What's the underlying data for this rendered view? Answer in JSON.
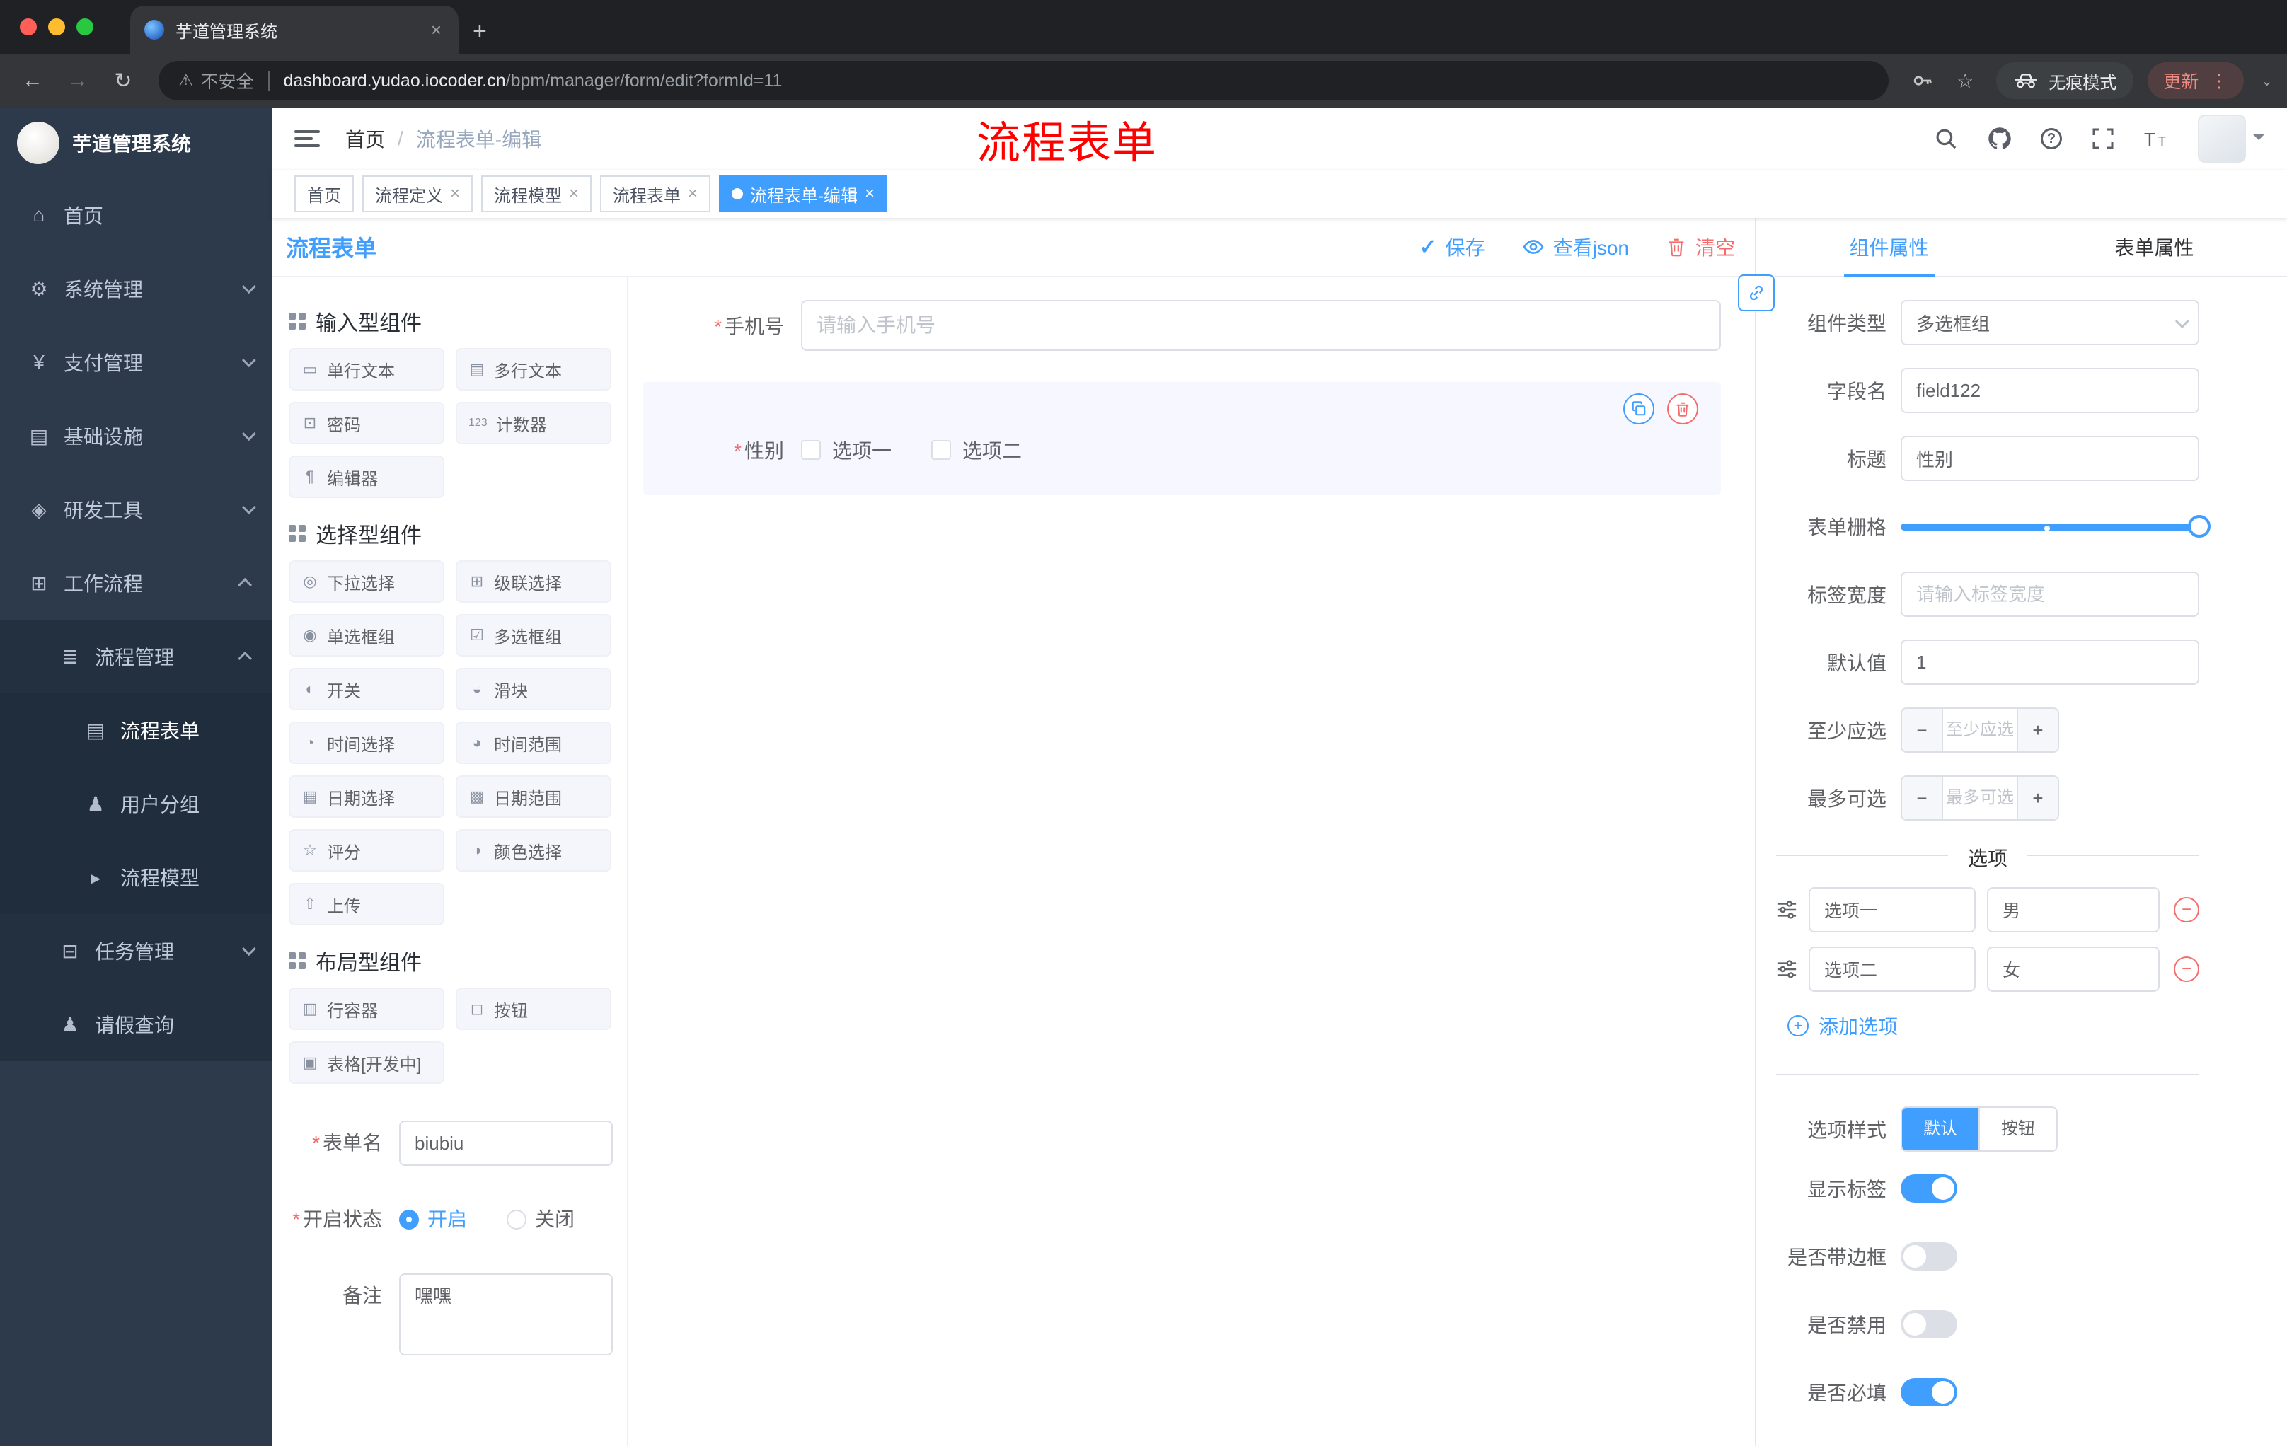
{
  "colors": {
    "primary": "#409eff",
    "danger": "#f56c6c",
    "overlay": "#ff0000",
    "sidebar_bg": "#2d3a4b"
  },
  "misc": {
    "required_mark": "*",
    "close_glyph": "×",
    "plus_glyph": "+",
    "minus_glyph": "−",
    "dots_glyph": "⋮",
    "star_glyph": "☆",
    "back_glyph": "←",
    "forward_glyph": "→",
    "reload_glyph": "↻",
    "warn_glyph": "⚠",
    "check_glyph": "✓",
    "caret_glyph": "⌄"
  },
  "browser": {
    "tab_title": "芋道管理系统",
    "security_label": "不安全",
    "url_domain": "dashboard.yudao.iocoder.cn",
    "url_path": "/bpm/manager/form/edit?formId=11",
    "incognito_label": "无痕模式",
    "update_label": "更新"
  },
  "sidebar": {
    "logo_title": "芋道管理系统",
    "items": [
      {
        "label": "首页",
        "icon": "home",
        "glyph": "⌂"
      },
      {
        "label": "系统管理",
        "icon": "gear",
        "glyph": "⚙"
      },
      {
        "label": "支付管理",
        "icon": "payment",
        "glyph": "¥"
      },
      {
        "label": "基础设施",
        "icon": "infrastructure",
        "glyph": "▤"
      },
      {
        "label": "研发工具",
        "icon": "dev-tools",
        "glyph": "◈"
      },
      {
        "label": "工作流程",
        "icon": "workflow",
        "glyph": "⊞"
      },
      {
        "label": "流程管理",
        "icon": "process-manage",
        "glyph": "≣"
      },
      {
        "label": "流程表单",
        "icon": "process-form",
        "glyph": "▤"
      },
      {
        "label": "用户分组",
        "icon": "user-group",
        "glyph": "♟"
      },
      {
        "label": "流程模型",
        "icon": "process-model",
        "glyph": "▸"
      },
      {
        "label": "任务管理",
        "icon": "task-manage",
        "glyph": "⊟"
      },
      {
        "label": "请假查询",
        "icon": "leave-query",
        "glyph": "♟"
      }
    ]
  },
  "header": {
    "breadcrumb_home": "首页",
    "breadcrumb_sep": "/",
    "breadcrumb_current": "流程表单-编辑",
    "overlay_title": "流程表单"
  },
  "tags": [
    {
      "label": "首页"
    },
    {
      "label": "流程定义"
    },
    {
      "label": "流程模型"
    },
    {
      "label": "流程表单"
    },
    {
      "label": "流程表单-编辑"
    }
  ],
  "designer": {
    "panel_title": "流程表单",
    "save_label": "保存",
    "view_json_label": "查看json",
    "clear_label": "清空",
    "palette": {
      "sections": [
        {
          "title": "输入型组件",
          "items": [
            {
              "label": "单行文本",
              "icon": "single-line-text",
              "glyph": "▭"
            },
            {
              "label": "多行文本",
              "icon": "multi-line-text",
              "glyph": "▤"
            },
            {
              "label": "密码",
              "icon": "password",
              "glyph": "⊡"
            },
            {
              "label": "计数器",
              "icon": "counter",
              "glyph": "123"
            },
            {
              "label": "编辑器",
              "icon": "editor",
              "glyph": "¶"
            }
          ]
        },
        {
          "title": "选择型组件",
          "items": [
            {
              "label": "下拉选择",
              "icon": "select",
              "glyph": "◎"
            },
            {
              "label": "级联选择",
              "icon": "cascader",
              "glyph": "⊞"
            },
            {
              "label": "单选框组",
              "icon": "radio-group",
              "glyph": "◉"
            },
            {
              "label": "多选框组",
              "icon": "checkbox-group",
              "glyph": "☑"
            },
            {
              "label": "开关",
              "icon": "switch",
              "glyph": "◐"
            },
            {
              "label": "滑块",
              "icon": "slider",
              "glyph": "◒"
            },
            {
              "label": "时间选择",
              "icon": "time-picker",
              "glyph": "◔"
            },
            {
              "label": "时间范围",
              "icon": "time-range",
              "glyph": "◕"
            },
            {
              "label": "日期选择",
              "icon": "date-picker",
              "glyph": "▦"
            },
            {
              "label": "日期范围",
              "icon": "date-range",
              "glyph": "▩"
            },
            {
              "label": "评分",
              "icon": "rate",
              "glyph": "☆"
            },
            {
              "label": "颜色选择",
              "icon": "color-picker",
              "glyph": "◑"
            },
            {
              "label": "上传",
              "icon": "upload",
              "glyph": "⇧"
            }
          ]
        },
        {
          "title": "布局型组件",
          "items": [
            {
              "label": "行容器",
              "icon": "row-container",
              "glyph": "▥"
            },
            {
              "label": "按钮",
              "icon": "button",
              "glyph": "◻"
            },
            {
              "label": "表格[开发中]",
              "icon": "table",
              "glyph": "▣"
            }
          ]
        }
      ]
    },
    "form_meta": {
      "name_label": "表单名",
      "name_value": "biubiu",
      "status_label": "开启状态",
      "status_on": "开启",
      "status_off": "关闭",
      "remark_label": "备注",
      "remark_value": "嘿嘿"
    },
    "canvas": {
      "phone_label": "手机号",
      "phone_placeholder": "请输入手机号",
      "gender_label": "性别",
      "gender_opt1": "选项一",
      "gender_opt2": "选项二"
    }
  },
  "props": {
    "tab_component": "组件属性",
    "tab_form": "表单属性",
    "type_label": "组件类型",
    "type_value": "多选框组",
    "field_label": "字段名",
    "field_value": "field122",
    "title_label": "标题",
    "title_value": "性别",
    "grid_label": "表单栅格",
    "label_width_label": "标签宽度",
    "label_width_placeholder": "请输入标签宽度",
    "default_label": "默认值",
    "default_value": "1",
    "min_label": "至少应选",
    "min_placeholder": "至少应选",
    "max_label": "最多可选",
    "max_placeholder": "最多可选",
    "options_title": "选项",
    "options": [
      {
        "label": "选项一",
        "value": "男"
      },
      {
        "label": "选项二",
        "value": "女"
      }
    ],
    "add_option_label": "添加选项",
    "style_label": "选项样式",
    "style_default": "默认",
    "style_button": "按钮",
    "toggle_show_label": "显示标签",
    "toggle_border": "是否带边框",
    "toggle_disabled": "是否禁用",
    "toggle_required": "是否必填"
  }
}
